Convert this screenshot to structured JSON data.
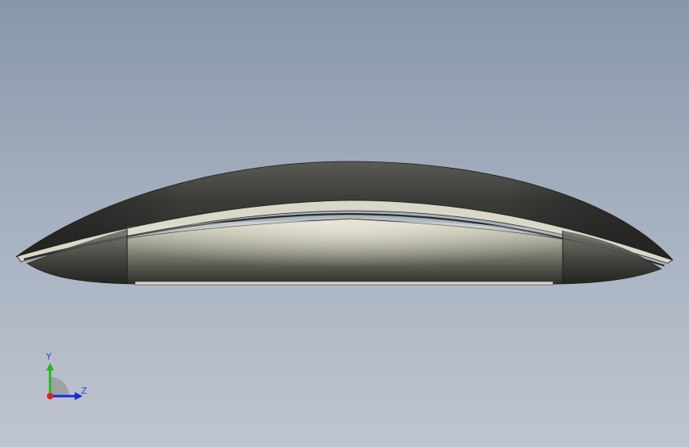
{
  "viewport": {
    "background_top": "#8797a9",
    "background_bottom": "#bfc5d0"
  },
  "model": {
    "name": "mouse-side-view",
    "body_color": "#4a4a45",
    "highlight_color": "#d9d8c8"
  },
  "triad": {
    "y_label": "Y",
    "z_label": "Z",
    "y_color": "#22bb22",
    "z_color": "#1a2bd6",
    "x_color": "#e02020"
  }
}
